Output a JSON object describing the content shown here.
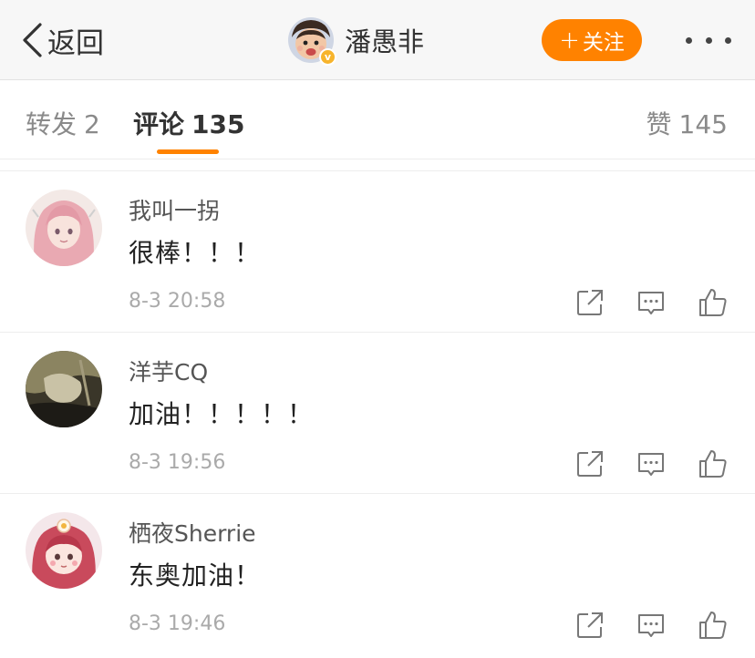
{
  "nav": {
    "back_label": "返回",
    "profile_name": "潘愚非",
    "verified_badge": "v",
    "follow_plus": "+",
    "follow_label": "关注",
    "more_icon": "more-dots-icon"
  },
  "tabs": {
    "repost": {
      "label": "转发",
      "count": "2"
    },
    "comment": {
      "label": "评论",
      "count": "135"
    },
    "like": {
      "label": "赞",
      "count": "145"
    }
  },
  "colors": {
    "accent": "#ff8200",
    "nav_bg": "#f7f7f7",
    "verified": "#f7b42c",
    "muted_text": "#aaaaaa"
  },
  "comments": [
    {
      "user": "我叫一拐",
      "text": "很棒！！！",
      "time": "8-3 20:58"
    },
    {
      "user": "洋芋CQ",
      "text": "加油！！！！！",
      "time": "8-3 19:56"
    },
    {
      "user": "栖夜Sherrie",
      "text": "东奥加油！",
      "time": "8-3 19:46"
    }
  ],
  "actions": [
    "share-icon",
    "reply-icon",
    "like-icon"
  ]
}
